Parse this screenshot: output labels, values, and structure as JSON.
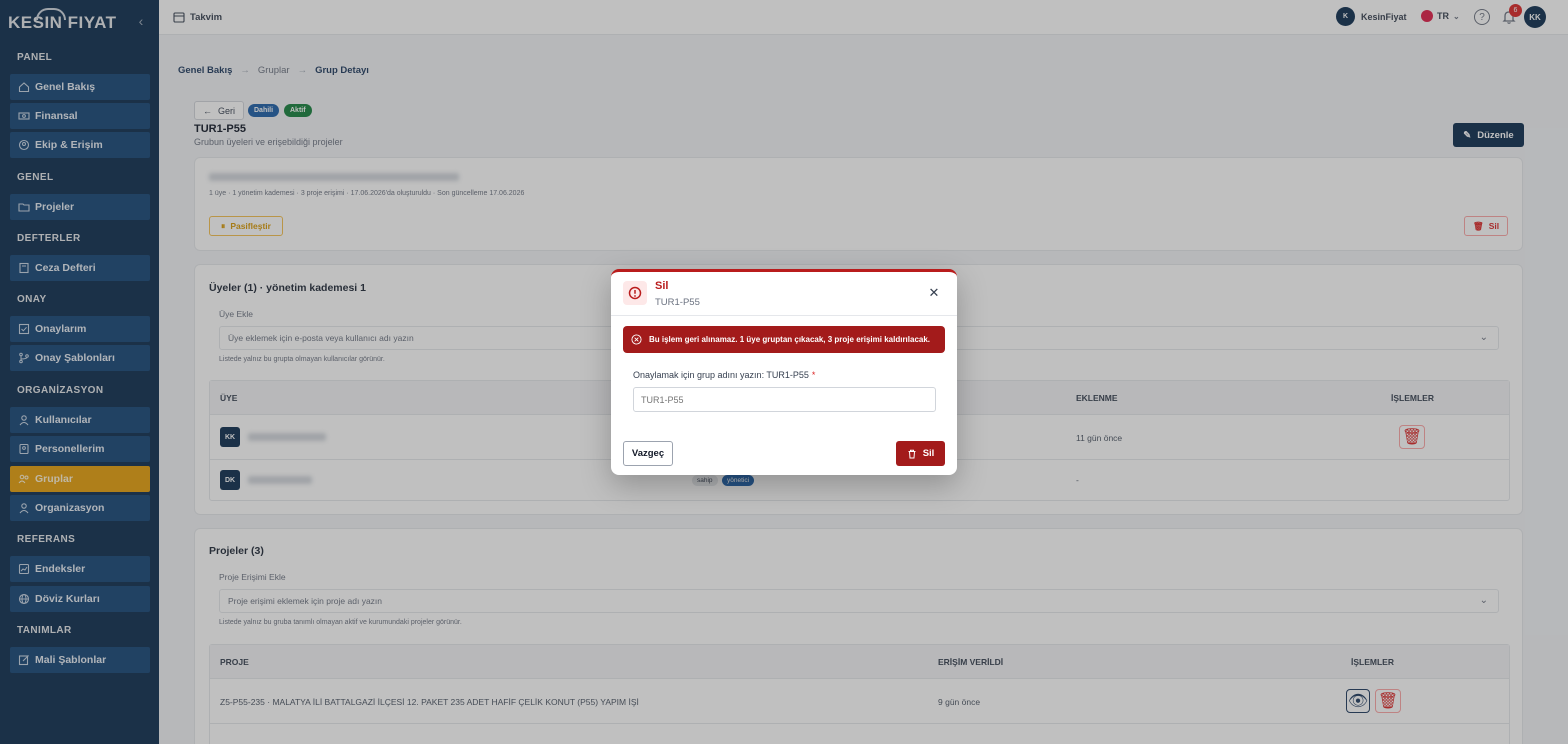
{
  "app": {
    "logo_text": "KESIN FIYAT"
  },
  "sidebar": {
    "sections": [
      {
        "title": "PANEL",
        "items": [
          {
            "label": "Genel Bakış",
            "icon": "home-icon"
          },
          {
            "label": "Finansal",
            "icon": "finance-icon"
          },
          {
            "label": "Ekip & Erişim",
            "icon": "team-icon"
          }
        ]
      },
      {
        "title": "GENEL",
        "items": [
          {
            "label": "Projeler",
            "icon": "folder-icon"
          }
        ]
      },
      {
        "title": "DEFTERLER",
        "items": [
          {
            "label": "Ceza Defteri",
            "icon": "book-icon"
          }
        ]
      },
      {
        "title": "ONAY",
        "items": [
          {
            "label": "Onaylarım",
            "icon": "check-icon"
          },
          {
            "label": "Onay Şablonları",
            "icon": "branch-icon"
          }
        ]
      },
      {
        "title": "ORGANİZASYON",
        "items": [
          {
            "label": "Kullanıcılar",
            "icon": "user-icon"
          },
          {
            "label": "Personellerim",
            "icon": "staff-icon"
          },
          {
            "label": "Gruplar",
            "icon": "group-icon",
            "active": true
          },
          {
            "label": "Organizasyon",
            "icon": "org-icon"
          }
        ]
      },
      {
        "title": "REFERANS",
        "items": [
          {
            "label": "Endeksler",
            "icon": "chart-icon"
          },
          {
            "label": "Döviz Kurları",
            "icon": "globe-icon"
          }
        ]
      },
      {
        "title": "TANIMLAR",
        "items": [
          {
            "label": "Mali Şablonlar",
            "icon": "template-icon"
          }
        ]
      }
    ]
  },
  "topbar": {
    "calendar_label": "Takvim",
    "user_name": "KesinFiyat",
    "user_initial": "K",
    "language": "TR",
    "notification_count": "6",
    "avatar_initials": "KK"
  },
  "breadcrumb": {
    "items": [
      "Genel Bakış",
      "Gruplar",
      "Grup Detayı"
    ]
  },
  "header": {
    "back_label": "Geri",
    "badge_internal": "Dahili",
    "badge_active": "Aktif",
    "title": "TUR1-P55",
    "subtitle": "Grubun üyeleri ve erişebildiği projeler",
    "edit_label": "Düzenle"
  },
  "summary_card": {
    "meta": "1 üye · 1 yönetim kademesi · 3 proje erişimi · 17.06.2026'da oluşturuldu · Son güncelleme 17.06.2026",
    "deactivate_label": "Pasifleştir",
    "delete_label": "Sil"
  },
  "members": {
    "title": "Üyeler (1) · yönetim kademesi 1",
    "add_label": "Üye Ekle",
    "add_placeholder": "Üye eklemek için e-posta veya kullanıcı adı yazın",
    "hint": "Listede yalnız bu grupta olmayan kullanıcılar görünür.",
    "columns": [
      "ÜYE",
      "EKLENME",
      "İŞLEMLER"
    ],
    "rows": [
      {
        "initials": "KK",
        "added": "11 gün önce"
      },
      {
        "initials": "DK",
        "tag_owner": "sahip",
        "tag_manager": "yönetici",
        "added": "-"
      }
    ]
  },
  "projects": {
    "title": "Projeler (3)",
    "add_label": "Proje Erişimi Ekle",
    "add_placeholder": "Proje erişimi eklemek için proje adı yazın",
    "hint": "Listede yalnız bu gruba tanımlı olmayan aktif ve kurumundaki projeler görünür.",
    "columns": [
      "PROJE",
      "ERİŞİM VERİLDİ",
      "İŞLEMLER"
    ],
    "rows": [
      {
        "name": "Z5-P55-235 · MALATYA İLİ BATTALGAZİ İLÇESİ 12. PAKET 235 ADET HAFİF ÇELİK KONUT (P55) YAPIM İŞİ",
        "granted": "9 gün önce"
      }
    ]
  },
  "modal": {
    "title": "Sil",
    "subtitle": "TUR1-P55",
    "alert": "Bu işlem geri alınamaz. 1 üye gruptan çıkacak, 3 proje erişimi kaldırılacak.",
    "confirm_label": "Onaylamak için grup adını yazın: TUR1-P55",
    "required_mark": "*",
    "input_placeholder": "TUR1-P55",
    "cancel_label": "Vazgeç",
    "delete_label": "Sil"
  },
  "colors": {
    "sidebar": "#0c2d4f",
    "nav_item": "#164677",
    "active": "#e69f0b",
    "danger": "#a31b1b"
  }
}
